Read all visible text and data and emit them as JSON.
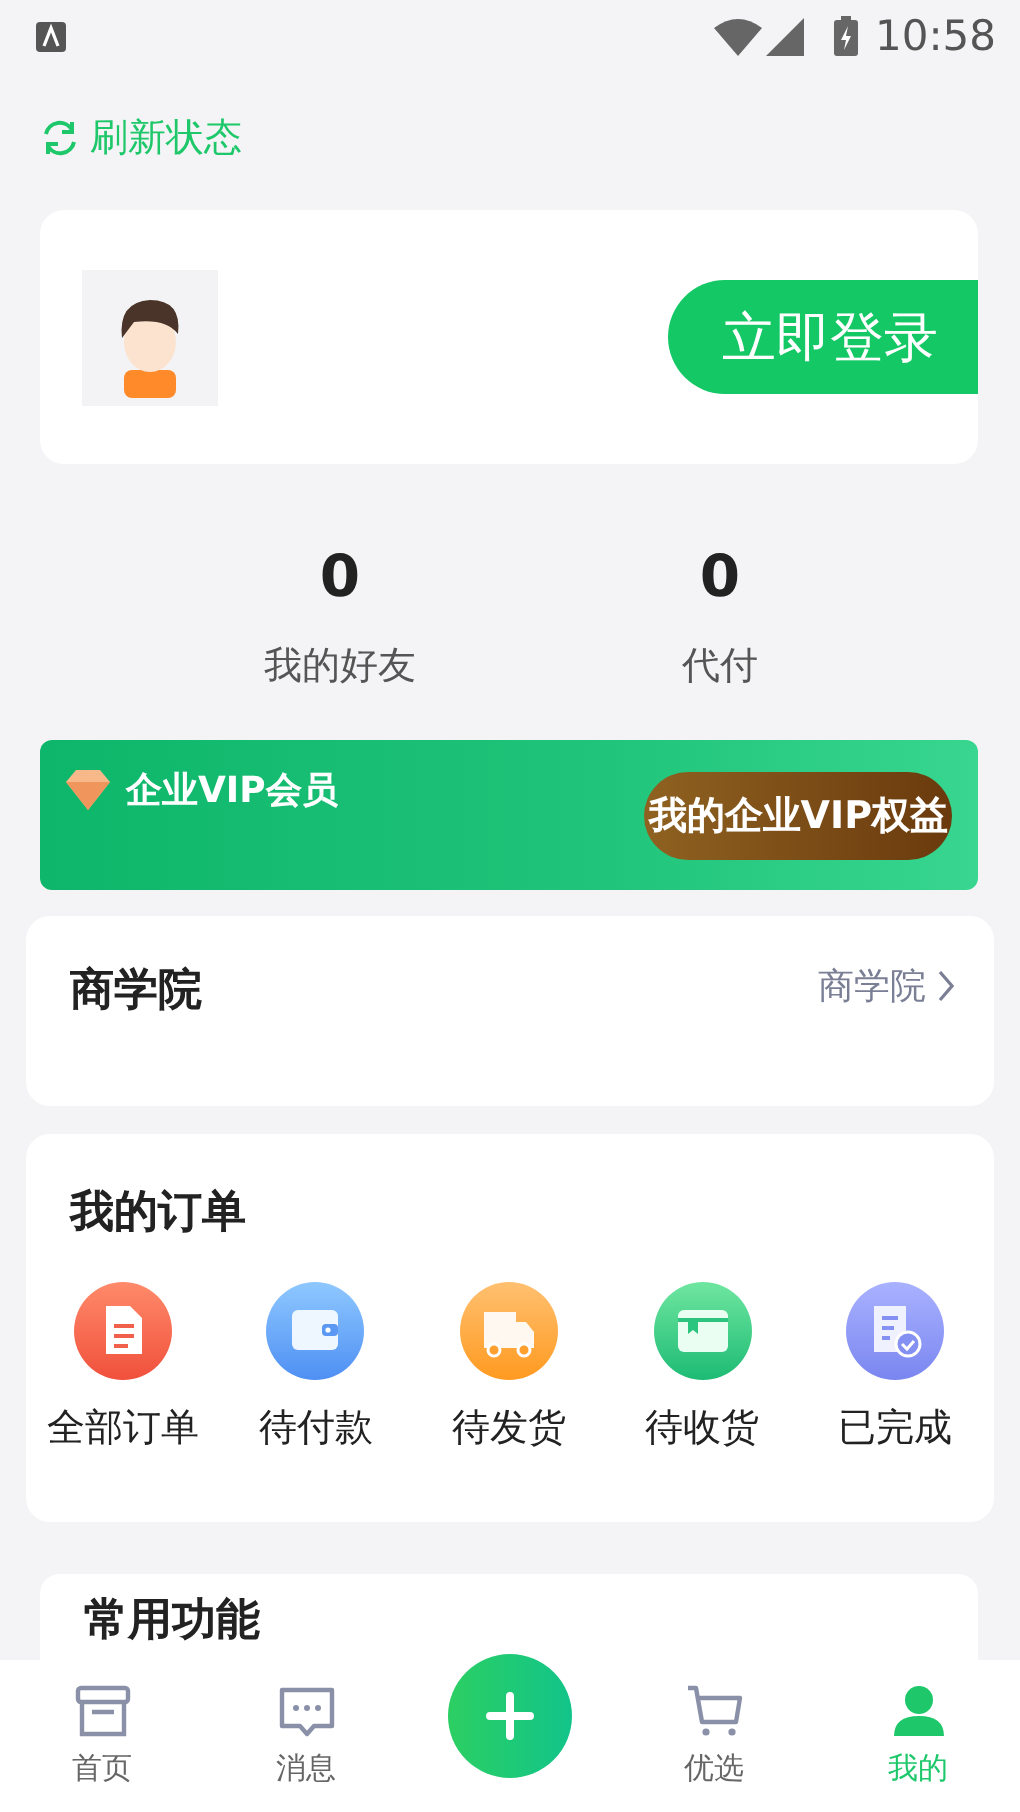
{
  "status_bar": {
    "time": "10:58"
  },
  "refresh": {
    "label": "刷新状态"
  },
  "login": {
    "button": "立即登录"
  },
  "stats": [
    {
      "value": "0",
      "label": "我的好友"
    },
    {
      "value": "0",
      "label": "代付"
    }
  ],
  "vip": {
    "title": "企业VIP会员",
    "button": "我的企业VIP权益"
  },
  "business_school": {
    "title": "商学院",
    "link": "商学院"
  },
  "orders": {
    "title": "我的订单",
    "items": [
      {
        "kind": "document",
        "label": "全部订单"
      },
      {
        "kind": "wallet",
        "label": "待付款"
      },
      {
        "kind": "truck",
        "label": "待发货"
      },
      {
        "kind": "box",
        "label": "待收货"
      },
      {
        "kind": "checklist",
        "label": "已完成"
      }
    ]
  },
  "common": {
    "title": "常用功能"
  },
  "tabs": [
    {
      "kind": "home",
      "label": "首页",
      "selected": false
    },
    {
      "kind": "message",
      "label": "消息",
      "selected": false
    },
    {
      "kind": "add",
      "selected": false
    },
    {
      "kind": "cart",
      "label": "优选",
      "selected": false
    },
    {
      "kind": "profile",
      "label": "我的",
      "selected": true
    }
  ]
}
